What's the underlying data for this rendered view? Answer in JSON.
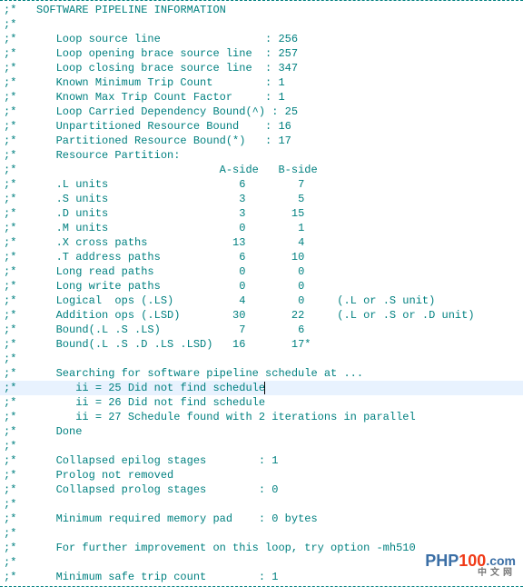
{
  "title": "SOFTWARE PIPELINE INFORMATION",
  "info": {
    "loop_source_line": {
      "label": "Loop source line               ",
      "value": "256"
    },
    "loop_open_brace": {
      "label": "Loop opening brace source line ",
      "value": "257"
    },
    "loop_close_brace": {
      "label": "Loop closing brace source line ",
      "value": "347"
    },
    "known_min_trip": {
      "label": "Known Minimum Trip Count       ",
      "value": "1"
    },
    "known_max_trip": {
      "label": "Known Max Trip Count Factor    ",
      "value": "1"
    },
    "loop_carried_dep": {
      "label": "Loop Carried Dependency Bound(^)",
      "value": "25"
    },
    "unpart_res_bound": {
      "label": "Unpartitioned Resource Bound   ",
      "value": "16"
    },
    "part_res_bound": {
      "label": "Partitioned Resource Bound(*)  ",
      "value": "17"
    }
  },
  "partition_header": "Resource Partition:",
  "col_a": "A-side",
  "col_b": "B-side",
  "rows": {
    "l_units": {
      "label": ".L units          ",
      "a": "6",
      "b": "7",
      "note": ""
    },
    "s_units": {
      "label": ".S units          ",
      "a": "3",
      "b": "5",
      "note": ""
    },
    "d_units": {
      "label": ".D units          ",
      "a": "3",
      "b": "15",
      "note": ""
    },
    "m_units": {
      "label": ".M units          ",
      "a": "0",
      "b": "1",
      "note": ""
    },
    "x_paths": {
      "label": ".X cross paths    ",
      "a": "13",
      "b": "4",
      "note": ""
    },
    "t_paths": {
      "label": ".T address paths  ",
      "a": "6",
      "b": "10",
      "note": ""
    },
    "long_read": {
      "label": "Long read paths   ",
      "a": "0",
      "b": "0",
      "note": ""
    },
    "long_write": {
      "label": "Long write paths  ",
      "a": "0",
      "b": "0",
      "note": ""
    },
    "logical": {
      "label": "Logical  ops (.LS)",
      "a": "4",
      "b": "0",
      "note": "(.L or .S unit)"
    },
    "addition": {
      "label": "Addition ops (.LSD)",
      "a": "30",
      "b": "22",
      "note": "(.L or .S or .D unit)"
    },
    "bound_ls": {
      "label": "Bound(.L .S .LS)  ",
      "a": "7",
      "b": "6",
      "note": ""
    },
    "bound_lsd": {
      "label": "Bound(.L .S .D .LS .LSD)",
      "a": "16",
      "b": "17*",
      "note": ""
    }
  },
  "search": {
    "header": "Searching for software pipeline schedule at ...",
    "ii25": "ii = 25 Did not find schedule",
    "ii26": "ii = 26 Did not find schedule",
    "ii27": "ii = 27 Schedule found with 2 iterations in parallel",
    "done": "Done"
  },
  "epilog": {
    "label": "Collapsed epilog stages     ",
    "value": "1"
  },
  "prolog_note": "Prolog not removed",
  "prolog": {
    "label": "Collapsed prolog stages     ",
    "value": "0"
  },
  "mem_pad": {
    "label": "Minimum required memory pad  ",
    "value": "0 bytes"
  },
  "improve": "For further improvement on this loop, try option -mh510",
  "safe_trip": {
    "label": "Minimum safe trip count     ",
    "value": "1"
  },
  "wm": {
    "p1": "PHP",
    "p2": "100",
    "p3": ".com",
    "sub": "中文网"
  }
}
